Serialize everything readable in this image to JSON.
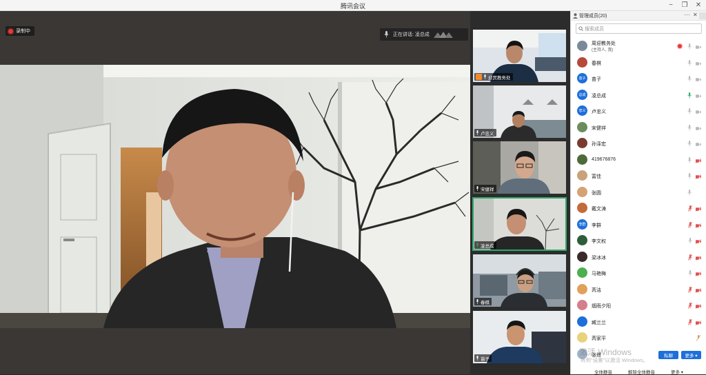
{
  "window": {
    "title": "腾讯会议"
  },
  "recording": {
    "label": "录制中"
  },
  "speaking": {
    "label": "正在讲话: 凌总成"
  },
  "tiles": [
    {
      "name": "迎宾教务处"
    },
    {
      "name": "卢忠义"
    },
    {
      "name": "宋健祥"
    },
    {
      "name": "凌总成"
    },
    {
      "name": "春棋"
    },
    {
      "name": "苗子"
    }
  ],
  "panel": {
    "title": "管理成员(20)",
    "search_placeholder": "搜索成员",
    "members": [
      {
        "name": "周迎教务处",
        "sub": "(主持人, 我)",
        "avatar": "",
        "avatar_color": "#7a8a99"
      },
      {
        "name": "春棋",
        "avatar": "",
        "avatar_color": "#b54a3a"
      },
      {
        "name": "苗子",
        "avatar": "苗子",
        "avatar_color": "#1e6fd9"
      },
      {
        "name": "凌总成",
        "avatar": "总成",
        "avatar_color": "#1e6fd9"
      },
      {
        "name": "卢忠义",
        "avatar": "忠义",
        "avatar_color": "#1e6fd9"
      },
      {
        "name": "宋健祥",
        "avatar": "",
        "avatar_color": "#6d8c5e"
      },
      {
        "name": "孙泽宏",
        "avatar": "",
        "avatar_color": "#7a3b2e"
      },
      {
        "name": "419676876",
        "avatar": "",
        "avatar_color": "#4d6b3a"
      },
      {
        "name": "富佳",
        "avatar": "",
        "avatar_color": "#c9a27a"
      },
      {
        "name": "张圆",
        "avatar": "",
        "avatar_color": "#d4a373"
      },
      {
        "name": "戴文涛",
        "avatar": "",
        "avatar_color": "#c46a3a"
      },
      {
        "name": "李群",
        "avatar": "李群",
        "avatar_color": "#1e6fd9"
      },
      {
        "name": "李文权",
        "avatar": "",
        "avatar_color": "#2f5d3a"
      },
      {
        "name": "梁冰冰",
        "avatar": "",
        "avatar_color": "#3a2a2a"
      },
      {
        "name": "马艳梅",
        "avatar": "",
        "avatar_color": "#4caf50"
      },
      {
        "name": "芮洁",
        "avatar": "",
        "avatar_color": "#e0a15a"
      },
      {
        "name": "烟雨夕阳",
        "avatar": "",
        "avatar_color": "#d47f8a"
      },
      {
        "name": "臧兰兰",
        "avatar": "",
        "avatar_color": "#1e6fd9"
      },
      {
        "name": "芮家平",
        "avatar": "",
        "avatar_color": "#e8d27a"
      },
      {
        "name": "张搭",
        "avatar": "",
        "avatar_color": "#9fb3c8"
      }
    ],
    "private_chat": "私聊",
    "more": "更多 ▾",
    "mute_all": "全体静音",
    "unmute_all": "解除全体静音",
    "more2": "更多 ▾"
  },
  "watermark": {
    "line1": "激活 Windows",
    "line2": "转到\"设置\"以激活 Windows。"
  },
  "colors": {
    "accent": "#1e6fd9",
    "speaking": "#2ea96b",
    "mute": "#e05050"
  }
}
